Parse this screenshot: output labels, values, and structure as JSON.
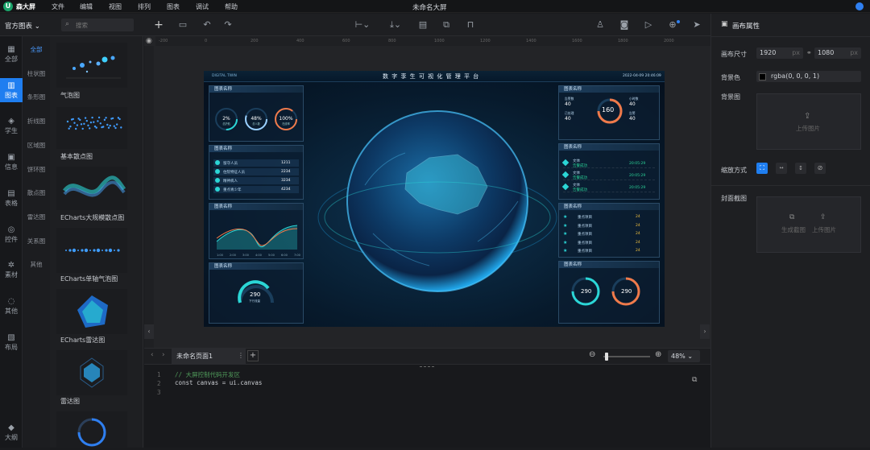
{
  "app": {
    "logo_letter": "U",
    "name": "森大屏",
    "doc_title": "未命名大屏"
  },
  "menu": [
    "文件",
    "编辑",
    "视图",
    "排列",
    "图表",
    "调试",
    "帮助"
  ],
  "toolbar": {
    "library_label": "官方图表",
    "search_placeholder": "搜索"
  },
  "rail": [
    {
      "icon": "grid-icon",
      "glyph": "▦",
      "label": "全部"
    },
    {
      "icon": "bar-chart-icon",
      "glyph": "▥",
      "label": "图表"
    },
    {
      "icon": "learn-icon",
      "glyph": "◈",
      "label": "学生"
    },
    {
      "icon": "info-icon",
      "glyph": "▣",
      "label": "信息"
    },
    {
      "icon": "table-icon",
      "glyph": "▤",
      "label": "表格"
    },
    {
      "icon": "control-icon",
      "glyph": "◎",
      "label": "控件"
    },
    {
      "icon": "material-icon",
      "glyph": "✲",
      "label": "素材"
    },
    {
      "icon": "other-icon",
      "glyph": "◌",
      "label": "其他"
    },
    {
      "icon": "layout-icon",
      "glyph": "▧",
      "label": "布局"
    },
    {
      "icon": "outline-icon",
      "glyph": "◆",
      "label": "大纲"
    }
  ],
  "categories": [
    "全部",
    "柱状图",
    "条形图",
    "折线图",
    "区域图",
    "饼环图",
    "散点图",
    "雷达图",
    "关系图",
    "其他"
  ],
  "gallery": [
    "气泡图",
    "基本散点图",
    "ECharts大规模散点图",
    "ECharts单轴气泡图",
    "ECharts雷达图",
    "雷达图"
  ],
  "ruler_ticks": [
    "-200",
    "0",
    "200",
    "400",
    "600",
    "800",
    "1000",
    "1200",
    "1400",
    "1600",
    "1800",
    "2000"
  ],
  "screen": {
    "brand": "DIGITAL TWIN",
    "title": "数 字 孪 生 可 视 化 管 理 平 台",
    "datetime": "2022-04-09 20:46:09",
    "panel_title": "图表名称",
    "rings": [
      {
        "value": "2",
        "unit": "%",
        "label": "总护航"
      },
      {
        "value": "48",
        "unit": "%",
        "label": "总人数"
      },
      {
        "value": "100",
        "unit": "%",
        "label": "在线率"
      }
    ],
    "list": [
      {
        "name": "留守人员",
        "value": "1211"
      },
      {
        "name": "住院特征人员",
        "value": "2234"
      },
      {
        "name": "精神病人",
        "value": "3234"
      },
      {
        "name": "重点青少年",
        "value": "4234"
      }
    ],
    "line_axis": [
      "1:00",
      "2:00",
      "3:00",
      "4:00",
      "5:00",
      "6:00",
      "7:00"
    ],
    "gauge_left": {
      "value": "290",
      "unit": "Mbps",
      "label": "下行流量",
      "min": "0",
      "max": "100"
    },
    "gauge_top": {
      "value": "160",
      "label": "总告警数",
      "stats": [
        {
          "label": "告警数",
          "value": "40"
        },
        {
          "label": "已处理",
          "value": "40"
        },
        {
          "label": "小时数",
          "value": "40"
        },
        {
          "label": "告警",
          "value": "40"
        }
      ]
    },
    "alarm_rows": [
      {
        "name": "文体",
        "tag": "告警成功",
        "time": "20:05:29"
      },
      {
        "name": "文体",
        "tag": "告警成功",
        "time": "20:05:29"
      },
      {
        "name": "文体",
        "tag": "告警成功",
        "time": "20:05:29"
      }
    ],
    "star_rows": [
      {
        "name": "重点项目",
        "value": "24"
      },
      {
        "name": "重点项目",
        "value": "24"
      },
      {
        "name": "重点项目",
        "value": "24"
      },
      {
        "name": "重点项目",
        "value": "24"
      },
      {
        "name": "重点项目",
        "value": "24"
      }
    ],
    "gauges_right": [
      {
        "value": "290",
        "unit": "Mbps",
        "label": "下行流量"
      },
      {
        "value": "290",
        "unit": "Mbps",
        "label": "下行流量"
      }
    ]
  },
  "pagebar": {
    "page_name": "未命名页面1",
    "zoom": "48%"
  },
  "code": {
    "lines": [
      "// 大屏控制代码开发区",
      "const canvas = ui.canvas",
      ""
    ]
  },
  "rightpanel": {
    "title": "画布属性",
    "size_label": "画布尺寸",
    "width": "1920",
    "height": "1080",
    "unit": "px",
    "bg_color_label": "背景色",
    "bg_color": "rgba(0, 0, 0, 1)",
    "bg_image_label": "背景图",
    "upload_label": "上传图片",
    "scale_label": "缩放方式",
    "cover_label": "封面截图",
    "generate_label": "生成截图",
    "upload2_label": "上传图片"
  },
  "colors": {
    "accent": "#1f7ef0",
    "panel_border": "#2a4a66",
    "cyan": "#2bd6d6",
    "orange": "#f07a4a"
  }
}
